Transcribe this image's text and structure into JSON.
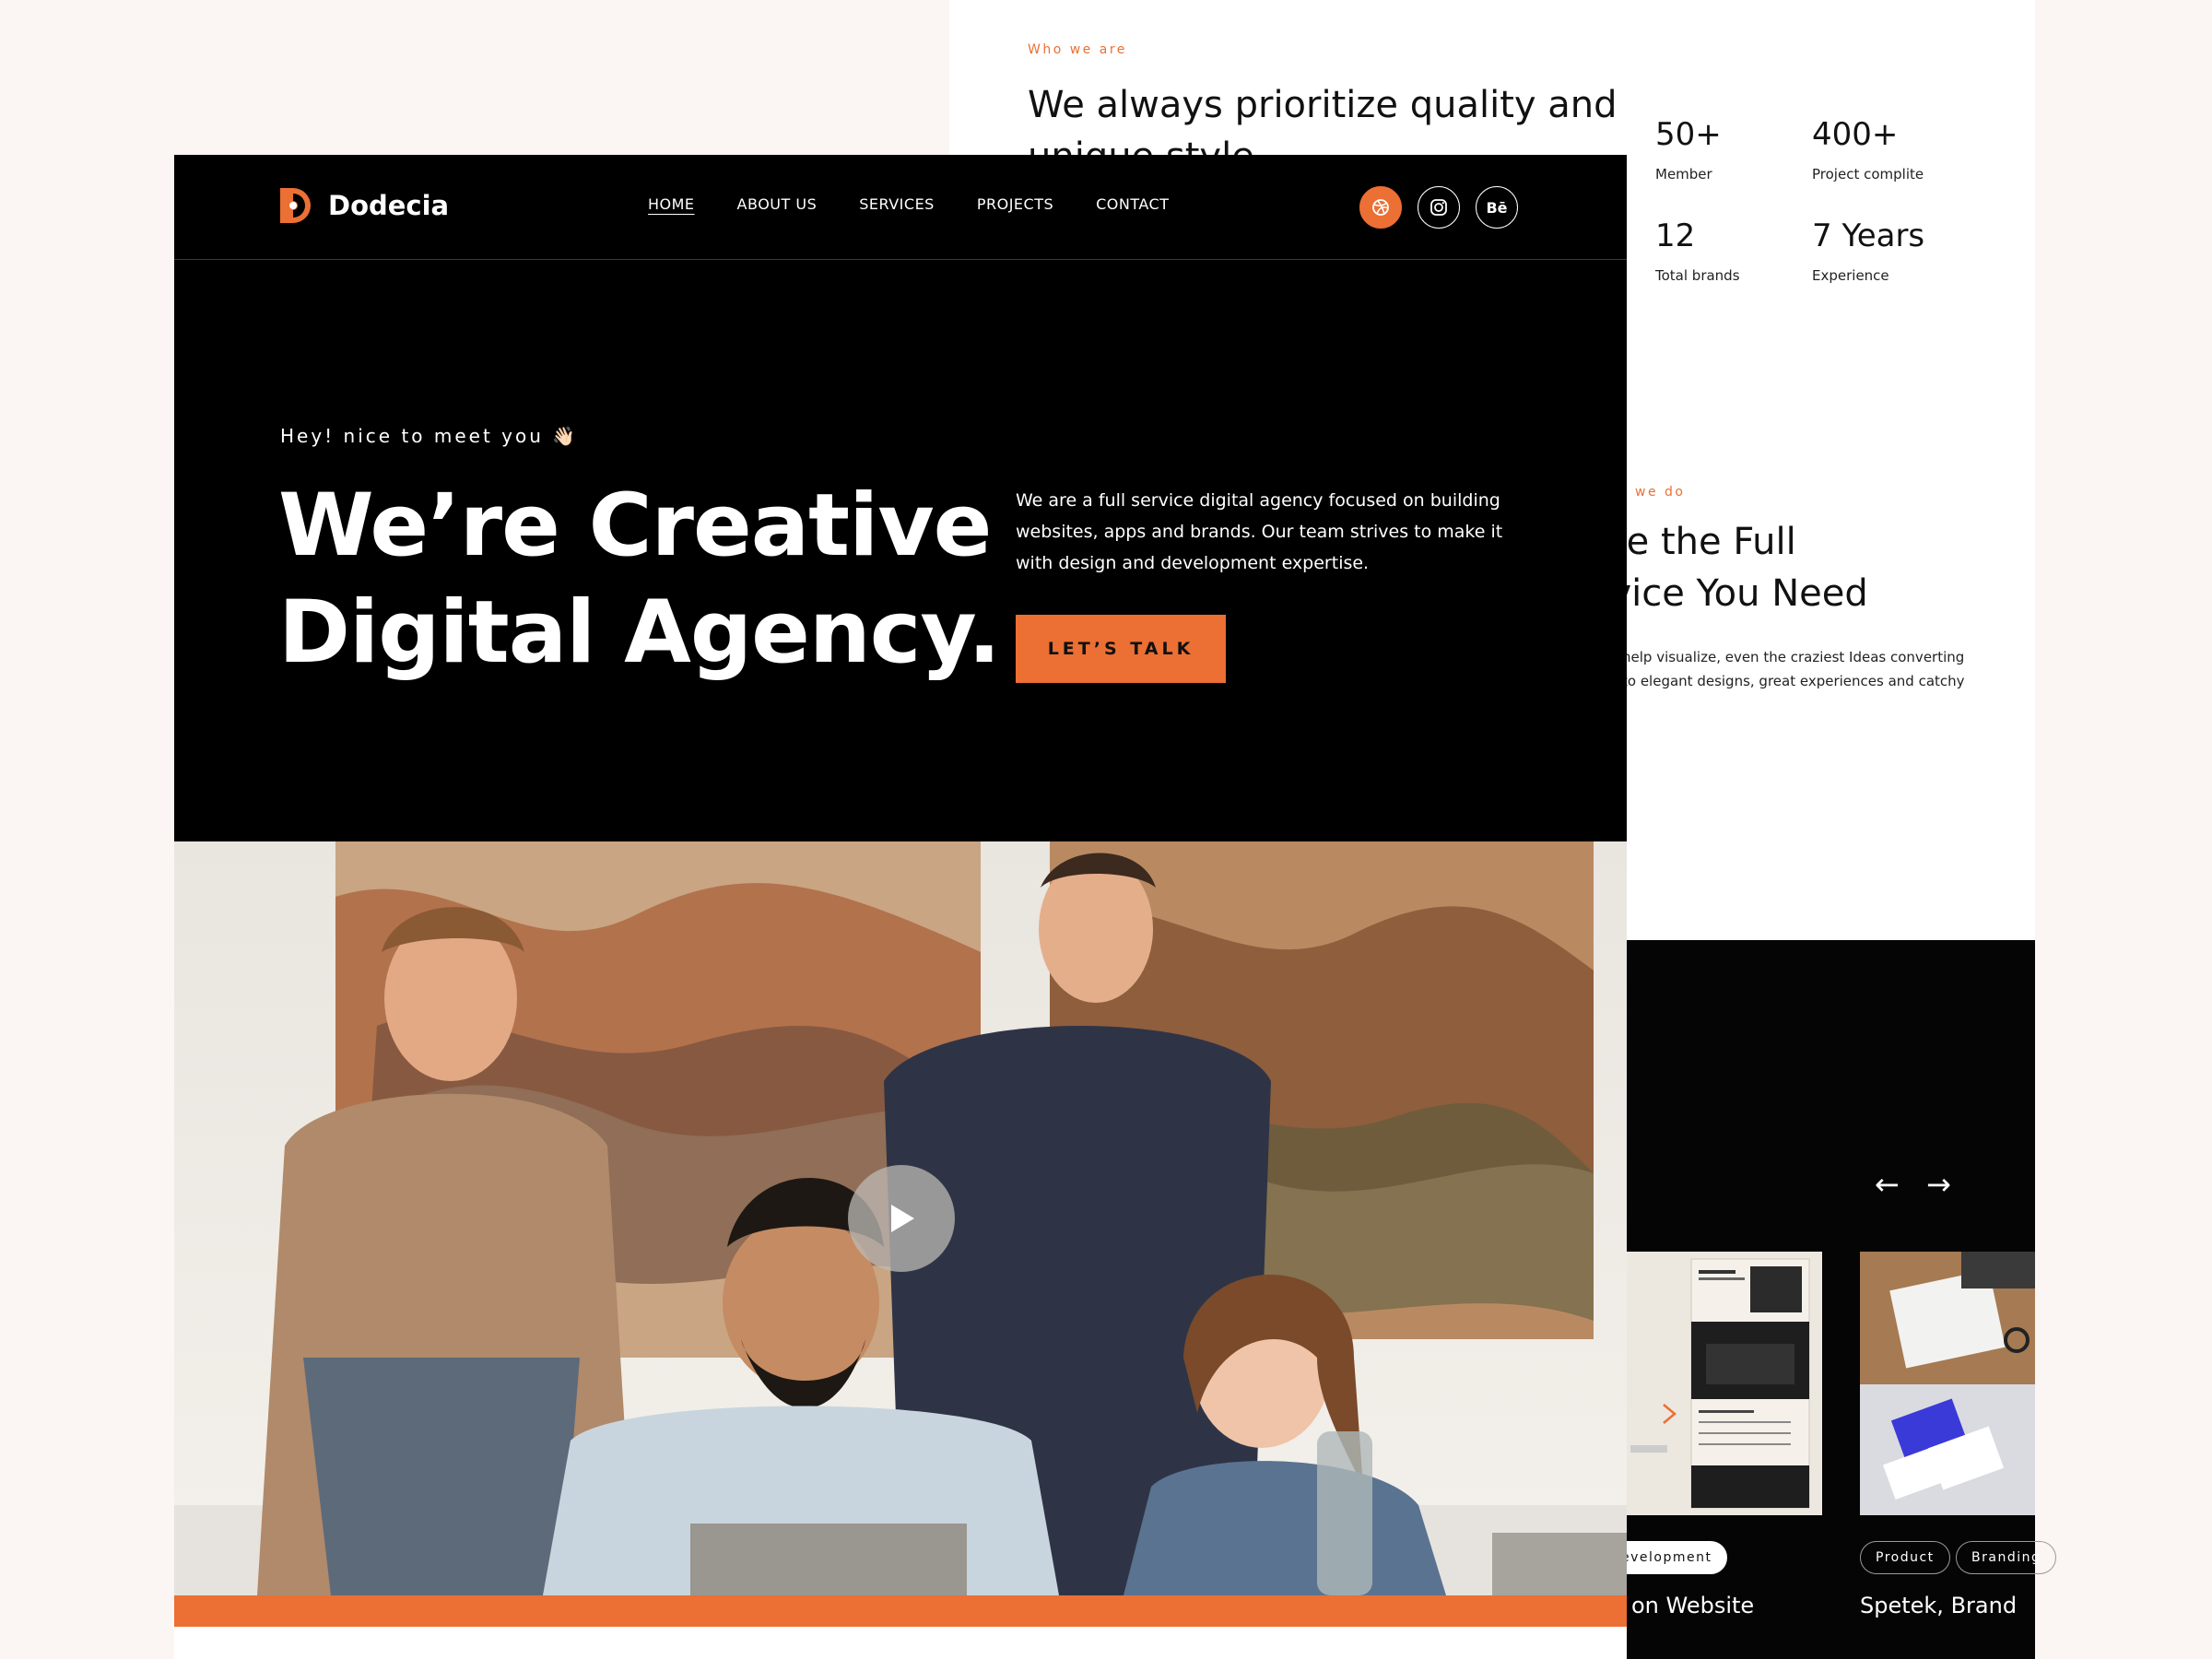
{
  "colors": {
    "accent": "#ec6f34",
    "dark": "#000000",
    "light_bg": "#fbf6f3"
  },
  "about": {
    "eyebrow": "Who we are",
    "title": "We always prioritize quality and unique style",
    "stats": [
      {
        "value": "50+",
        "label": "Member"
      },
      {
        "value": "400+",
        "label": "Project complite"
      },
      {
        "value": "12",
        "label": "Total brands"
      },
      {
        "value": "7 Years",
        "label": "Experience"
      }
    ]
  },
  "services": {
    "eyebrow": "we do",
    "title_line1": "'ve the Full",
    "title_line2": "rvice You Need",
    "text": "help visualize, even the craziest Ideas converting to elegant designs, great experiences and catchy"
  },
  "projects": {
    "prev_icon": "arrow-left-icon",
    "next_icon": "arrow-right-icon",
    "prev": "←",
    "next": "→",
    "cards": [
      {
        "tags": [
          "evelopment"
        ],
        "title": "on Website"
      },
      {
        "tags": [
          "Product",
          "Branding"
        ],
        "title": "Spetek, Brand"
      }
    ]
  },
  "nav": {
    "brand": "Dodecia",
    "items": [
      "HOME",
      "ABOUT US",
      "SERVICES",
      "PROJECTS",
      "CONTACT"
    ],
    "socials": [
      {
        "icon": "dribbble-icon"
      },
      {
        "icon": "instagram-icon"
      },
      {
        "icon": "behance-icon",
        "label": "Bē"
      }
    ]
  },
  "hero": {
    "greeting": "Hey! nice to meet you 👋🏻",
    "headline_line1": "We’re Creative",
    "headline_line2": "Digital Agency.",
    "description": "We are a full service digital agency focused on building websites, apps and brands. Our team strives to make it with design and development expertise.",
    "cta": "LET’S TALK"
  },
  "media": {
    "play_icon": "play-icon"
  }
}
